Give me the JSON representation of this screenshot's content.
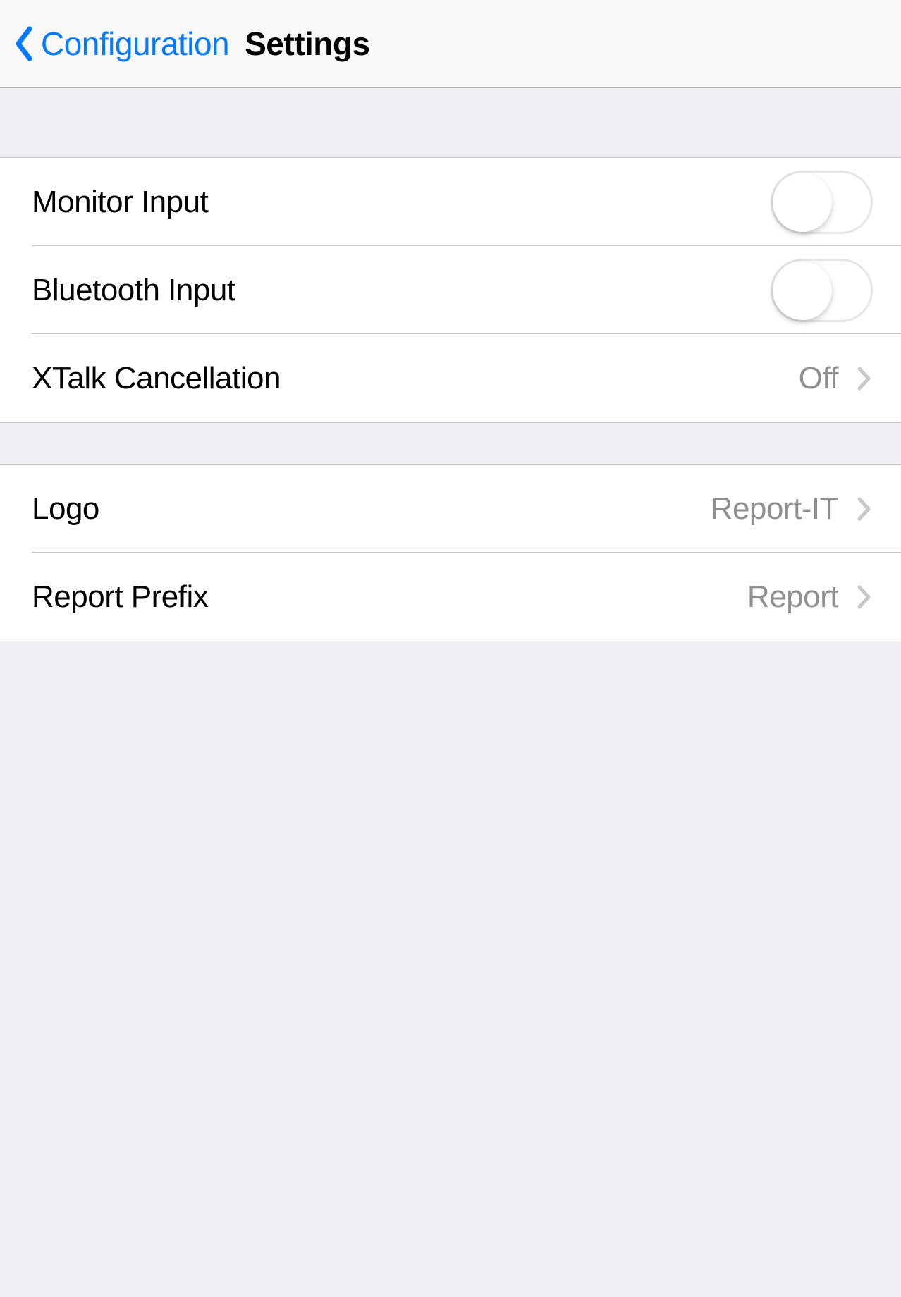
{
  "nav": {
    "back_label": "Configuration",
    "title": "Settings"
  },
  "group1": {
    "monitor_input": {
      "label": "Monitor Input",
      "state": "off"
    },
    "bluetooth_input": {
      "label": "Bluetooth Input",
      "state": "off"
    },
    "xtalk": {
      "label": "XTalk Cancellation",
      "value": "Off"
    }
  },
  "group2": {
    "logo": {
      "label": "Logo",
      "value": "Report-IT"
    },
    "report_prefix": {
      "label": "Report Prefix",
      "value": "Report"
    }
  }
}
